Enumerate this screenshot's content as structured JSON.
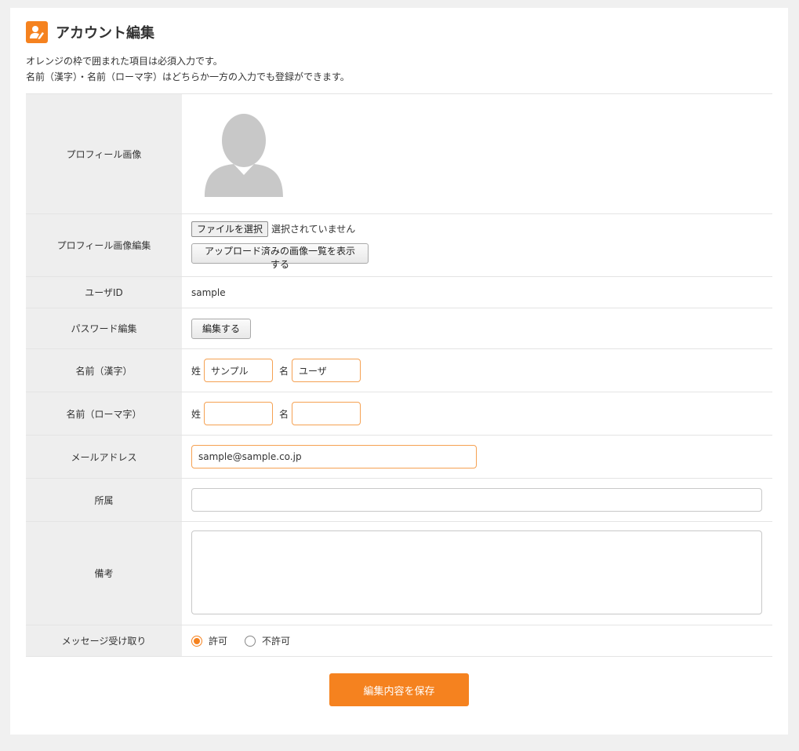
{
  "header": {
    "title": "アカウント編集",
    "icon": "user-edit-icon"
  },
  "description": {
    "line1": "オレンジの枠で囲まれた項目は必須入力です。",
    "line2": "名前（漢字）・名前（ローマ字）はどちらか一方の入力でも登録ができます。"
  },
  "rows": {
    "profile_image": {
      "label": "プロフィール画像"
    },
    "profile_image_edit": {
      "label": "プロフィール画像編集",
      "file_button": "ファイルを選択",
      "file_status": "選択されていません",
      "uploaded_button": "アップロード済みの画像一覧を表示する"
    },
    "user_id": {
      "label": "ユーザID",
      "value": "sample"
    },
    "password": {
      "label": "パスワード編集",
      "button": "編集する"
    },
    "name_kanji": {
      "label": "名前（漢字）",
      "last_label": "姓",
      "last_value": "サンプル",
      "first_label": "名",
      "first_value": "ユーザ"
    },
    "name_roman": {
      "label": "名前（ローマ字）",
      "last_label": "姓",
      "last_value": "",
      "first_label": "名",
      "first_value": ""
    },
    "email": {
      "label": "メールアドレス",
      "value": "sample@sample.co.jp"
    },
    "affiliation": {
      "label": "所属",
      "value": ""
    },
    "notes": {
      "label": "備考",
      "value": ""
    },
    "message": {
      "label": "メッセージ受け取り",
      "allow": "許可",
      "deny": "不許可",
      "selected": "許可"
    }
  },
  "save_button": "編集内容を保存",
  "colors": {
    "accent": "#f5821f",
    "label_bg": "#eeeeee",
    "page_bg": "#f0f0f0"
  }
}
